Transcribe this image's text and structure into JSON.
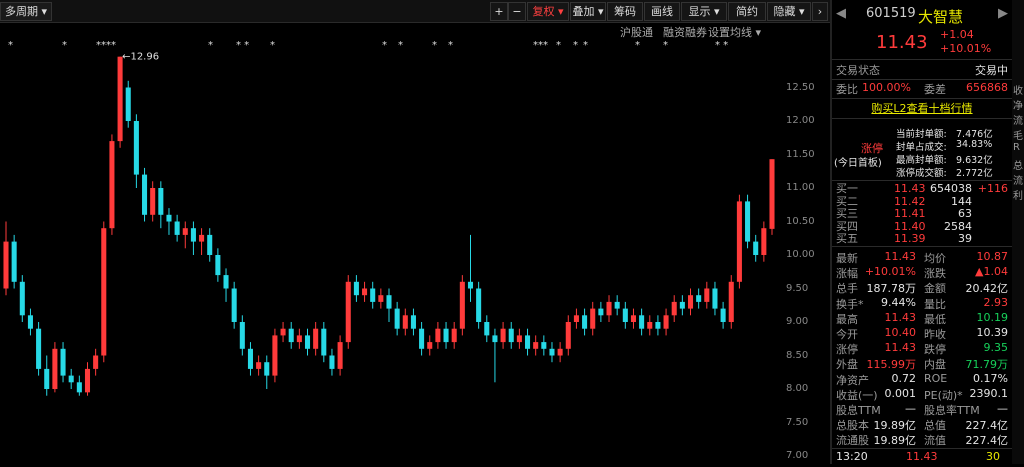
{
  "toolbar": {
    "period": "多周期",
    "plus": "+",
    "minus": "−",
    "buttons": [
      "复权",
      "叠加",
      "筹码",
      "画线",
      "显示",
      "简约",
      "隐藏"
    ]
  },
  "subbar": {
    "items": [
      "沪股通",
      "融资融券",
      "设置均线"
    ]
  },
  "marks": [
    "*",
    "*",
    "****",
    "*",
    "* *",
    "*",
    "*",
    "*",
    "*",
    "*",
    "***",
    "*",
    "*",
    "*",
    "*",
    "*",
    "* *"
  ],
  "peak_label": "←12.96",
  "price_ticks": [
    "12.50",
    "12.00",
    "11.50",
    "11.00",
    "10.50",
    "10.00",
    "9.50",
    "9.00",
    "8.50",
    "8.00",
    "7.50",
    "7.00"
  ],
  "chart_data": {
    "type": "candlestick",
    "ylim": [
      7.0,
      13.0
    ],
    "candles": [
      [
        9.5,
        10.2,
        10.5,
        9.4
      ],
      [
        10.2,
        9.6,
        10.3,
        9.5
      ],
      [
        9.6,
        9.1,
        9.7,
        9.0
      ],
      [
        9.1,
        8.9,
        9.2,
        8.8
      ],
      [
        8.9,
        8.3,
        9.0,
        8.2
      ],
      [
        8.3,
        8.0,
        8.5,
        7.9
      ],
      [
        8.0,
        8.6,
        8.7,
        7.95
      ],
      [
        8.6,
        8.2,
        8.7,
        8.1
      ],
      [
        8.2,
        8.1,
        8.3,
        8.0
      ],
      [
        8.1,
        7.95,
        8.2,
        7.9
      ],
      [
        7.95,
        8.3,
        8.4,
        7.9
      ],
      [
        8.3,
        8.5,
        8.6,
        8.2
      ],
      [
        8.5,
        10.4,
        10.5,
        8.4
      ],
      [
        10.4,
        11.7,
        11.8,
        10.3
      ],
      [
        11.7,
        12.96,
        12.96,
        11.6
      ],
      [
        12.5,
        12.0,
        12.6,
        11.9
      ],
      [
        12.0,
        11.2,
        12.1,
        11.0
      ],
      [
        11.2,
        10.6,
        11.3,
        10.5
      ],
      [
        10.6,
        11.0,
        11.1,
        10.5
      ],
      [
        11.0,
        10.6,
        11.1,
        10.4
      ],
      [
        10.6,
        10.5,
        10.7,
        10.3
      ],
      [
        10.5,
        10.3,
        10.6,
        10.2
      ],
      [
        10.3,
        10.4,
        10.5,
        10.1
      ],
      [
        10.4,
        10.2,
        10.5,
        10.0
      ],
      [
        10.2,
        10.3,
        10.4,
        10.0
      ],
      [
        10.3,
        10.0,
        10.4,
        9.9
      ],
      [
        10.0,
        9.7,
        10.1,
        9.6
      ],
      [
        9.7,
        9.5,
        9.8,
        9.3
      ],
      [
        9.5,
        9.0,
        9.6,
        8.9
      ],
      [
        9.0,
        8.6,
        9.1,
        8.5
      ],
      [
        8.6,
        8.3,
        8.7,
        8.2
      ],
      [
        8.3,
        8.4,
        8.5,
        8.2
      ],
      [
        8.4,
        8.2,
        8.5,
        8.0
      ],
      [
        8.2,
        8.8,
        8.9,
        8.1
      ],
      [
        8.8,
        8.9,
        9.0,
        8.7
      ],
      [
        8.9,
        8.7,
        9.0,
        8.6
      ],
      [
        8.7,
        8.8,
        8.9,
        8.6
      ],
      [
        8.8,
        8.6,
        8.9,
        8.5
      ],
      [
        8.6,
        8.9,
        9.0,
        8.5
      ],
      [
        8.9,
        8.5,
        9.0,
        8.4
      ],
      [
        8.5,
        8.3,
        8.6,
        8.2
      ],
      [
        8.3,
        8.7,
        8.8,
        8.2
      ],
      [
        8.7,
        9.6,
        9.7,
        8.6
      ],
      [
        9.6,
        9.4,
        9.7,
        9.3
      ],
      [
        9.4,
        9.5,
        9.6,
        9.3
      ],
      [
        9.5,
        9.3,
        9.6,
        9.2
      ],
      [
        9.3,
        9.4,
        9.5,
        9.2
      ],
      [
        9.4,
        9.2,
        9.5,
        9.0
      ],
      [
        9.2,
        8.9,
        9.3,
        8.8
      ],
      [
        8.9,
        9.1,
        9.2,
        8.8
      ],
      [
        9.1,
        8.9,
        9.2,
        8.8
      ],
      [
        8.9,
        8.6,
        9.0,
        8.5
      ],
      [
        8.6,
        8.7,
        8.8,
        8.5
      ],
      [
        8.7,
        8.9,
        9.0,
        8.6
      ],
      [
        8.9,
        8.7,
        9.0,
        8.6
      ],
      [
        8.7,
        8.9,
        9.0,
        8.6
      ],
      [
        8.9,
        9.6,
        9.7,
        8.8
      ],
      [
        9.6,
        9.5,
        10.3,
        9.3
      ],
      [
        9.5,
        9.0,
        9.6,
        8.9
      ],
      [
        9.0,
        8.8,
        9.1,
        8.7
      ],
      [
        8.8,
        8.7,
        8.9,
        8.1
      ],
      [
        8.7,
        8.9,
        9.0,
        8.6
      ],
      [
        8.9,
        8.7,
        9.0,
        8.6
      ],
      [
        8.7,
        8.8,
        8.9,
        8.6
      ],
      [
        8.8,
        8.6,
        8.9,
        8.5
      ],
      [
        8.6,
        8.7,
        8.8,
        8.5
      ],
      [
        8.7,
        8.6,
        8.8,
        8.5
      ],
      [
        8.6,
        8.5,
        8.7,
        8.4
      ],
      [
        8.5,
        8.6,
        8.7,
        8.4
      ],
      [
        8.6,
        9.0,
        9.1,
        8.5
      ],
      [
        9.0,
        9.1,
        9.2,
        8.9
      ],
      [
        9.1,
        8.9,
        9.2,
        8.8
      ],
      [
        8.9,
        9.2,
        9.3,
        8.8
      ],
      [
        9.2,
        9.1,
        9.3,
        9.0
      ],
      [
        9.1,
        9.3,
        9.4,
        9.0
      ],
      [
        9.3,
        9.2,
        9.4,
        9.1
      ],
      [
        9.2,
        9.0,
        9.3,
        8.9
      ],
      [
        9.0,
        9.1,
        9.2,
        8.9
      ],
      [
        9.1,
        8.9,
        9.2,
        8.8
      ],
      [
        8.9,
        9.0,
        9.1,
        8.8
      ],
      [
        9.0,
        8.9,
        9.1,
        8.8
      ],
      [
        8.9,
        9.1,
        9.2,
        8.8
      ],
      [
        9.1,
        9.3,
        9.4,
        9.0
      ],
      [
        9.3,
        9.2,
        9.4,
        9.1
      ],
      [
        9.2,
        9.4,
        9.5,
        9.1
      ],
      [
        9.4,
        9.3,
        9.5,
        9.2
      ],
      [
        9.3,
        9.5,
        9.6,
        9.2
      ],
      [
        9.5,
        9.2,
        9.6,
        9.1
      ],
      [
        9.2,
        9.0,
        9.3,
        8.9
      ],
      [
        9.0,
        9.6,
        9.7,
        8.9
      ],
      [
        9.6,
        10.8,
        10.9,
        9.5
      ],
      [
        10.8,
        10.2,
        10.9,
        10.1
      ],
      [
        10.2,
        10.0,
        10.3,
        9.9
      ],
      [
        10.0,
        10.4,
        10.5,
        9.9
      ],
      [
        10.39,
        11.43,
        11.43,
        10.3
      ]
    ]
  },
  "quote": {
    "code": "601519",
    "name": "大智慧",
    "price": "11.43",
    "change": "+1.04",
    "change_pct": "+10.01%",
    "status_label": "交易状态",
    "status_value": "交易中",
    "weibi_label": "委比",
    "weibi_value": "100.00%",
    "weicha_label": "委差",
    "weicha_value": "656868",
    "l2_link": "购买L2查看十档行情",
    "limit_title": "涨停",
    "limit_sub": "(今日首板)",
    "limit_stats": [
      [
        "当前封单额:",
        "7.476亿"
      ],
      [
        "封单占成交:",
        "34.83%"
      ],
      [
        "最高封单额:",
        "9.632亿"
      ],
      [
        "涨停成交额:",
        "2.772亿"
      ]
    ],
    "bids": [
      [
        "买一",
        "11.43",
        "654038",
        "+116"
      ],
      [
        "买二",
        "11.42",
        "144",
        ""
      ],
      [
        "买三",
        "11.41",
        "63",
        ""
      ],
      [
        "买四",
        "11.40",
        "2584",
        ""
      ],
      [
        "买五",
        "11.39",
        "39",
        ""
      ]
    ],
    "stats": [
      [
        "最新",
        "11.43",
        "均价",
        "10.87"
      ],
      [
        "涨幅",
        "+10.01%",
        "涨跌",
        "▲1.04"
      ],
      [
        "总手",
        "187.78万",
        "金额",
        "20.42亿"
      ],
      [
        "换手*",
        "9.44%",
        "量比",
        "2.93"
      ],
      [
        "最高",
        "11.43",
        "最低",
        "10.19"
      ],
      [
        "今开",
        "10.40",
        "昨收",
        "10.39"
      ],
      [
        "涨停",
        "11.43",
        "跌停",
        "9.35"
      ],
      [
        "外盘",
        "115.99万",
        "内盘",
        "71.79万"
      ],
      [
        "净资产",
        "0.72",
        "ROE",
        "0.17%"
      ],
      [
        "收益(一)",
        "0.001",
        "PE(动)*",
        "2390.1"
      ],
      [
        "股息TTM",
        "—",
        "股息率TTM",
        "—"
      ],
      [
        "总股本",
        "19.89亿",
        "总值",
        "227.4亿"
      ],
      [
        "流通股",
        "19.89亿",
        "流值",
        "227.4亿"
      ]
    ],
    "tick_time": "13:20",
    "tick_price": "11.43",
    "tick_vol": "30"
  },
  "right_strip": [
    "收",
    "净",
    "流",
    "毛",
    "R",
    "总",
    "流",
    "利"
  ]
}
